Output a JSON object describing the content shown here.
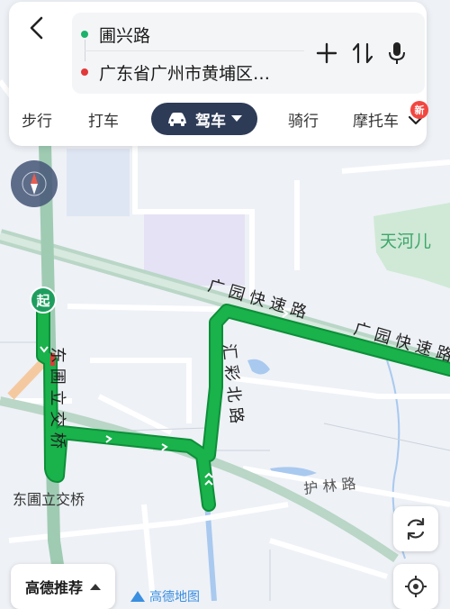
{
  "route": {
    "start_point": "圃兴路",
    "end_point": "广东省广州市黄埔区…"
  },
  "tabs": {
    "walk": "步行",
    "taxi": "打车",
    "drive": "驾车",
    "ride": "骑行",
    "moto": "摩托车"
  },
  "badge": {
    "new": "新"
  },
  "map": {
    "labels": {
      "guangyuan_1": "广 园 快 速 路",
      "guangyuan_2": "广 园 快 速 路",
      "huicai": "汇 彩 北 路",
      "dongpu_bridge_v": "东 圃 立 交 桥",
      "dongpu_bridge": "东圃立交桥",
      "hulin": "护 林 路",
      "tianhe": "天河儿"
    },
    "start_pin": "起",
    "colors": {
      "route": "#19b24b",
      "route_outline": "#0d8f39",
      "road": "#ffffff",
      "expressway": "#b9d6c6",
      "water": "#a9c9ef",
      "park": "#cfe9d6"
    }
  },
  "controls": {
    "recommend": "高德推荐",
    "watermark": "高德地图"
  },
  "icons": {
    "back": "chevron-left-icon",
    "add": "plus-icon",
    "swap": "swap-vertical-icon",
    "mic": "microphone-icon",
    "car": "car-icon",
    "more": "chevron-down-icon",
    "compass": "compass-icon",
    "refresh": "refresh-icon",
    "locate": "locate-icon"
  }
}
